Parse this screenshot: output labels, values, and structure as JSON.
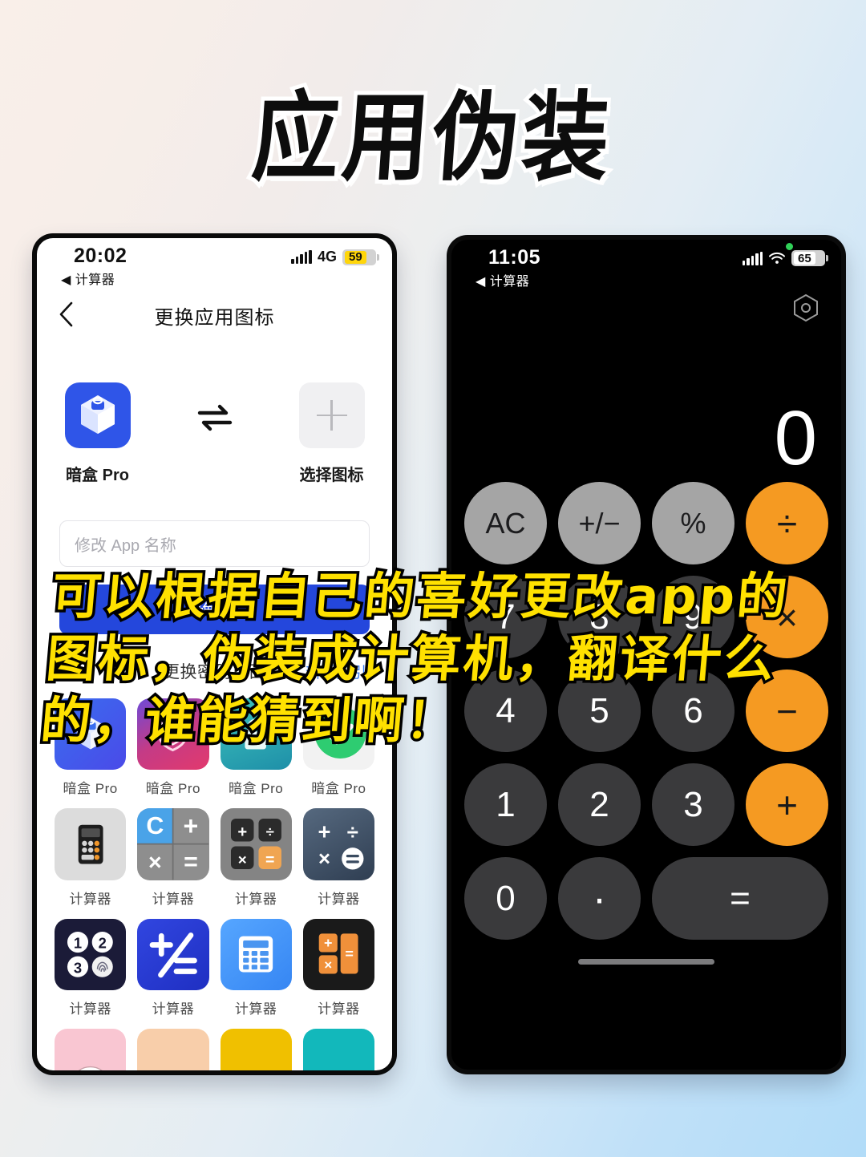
{
  "poster": {
    "title": "应用伪装",
    "caption": "可以根据自己的喜好更改app的图标，伪装成计算机，翻译什么的，谁能猜到啊！"
  },
  "left_phone": {
    "status": {
      "time": "20:02",
      "back_label": "◀ 计算器",
      "network": "4G",
      "battery": "59"
    },
    "nav": {
      "title": "更换应用图标"
    },
    "current_icon": {
      "label": "暗盒 Pro"
    },
    "picker": {
      "label": "选择图标"
    },
    "name_input": {
      "placeholder": "修改 App 名称",
      "value": ""
    },
    "confirm_button": "确定",
    "section": {
      "title": "更换密码页面",
      "link": "新手指引"
    },
    "icon_grid": [
      {
        "label": "暗盒 Pro",
        "icon": "box-blue-icon",
        "color": "#3359e6"
      },
      {
        "label": "暗盒 Pro",
        "icon": "shield-pink-icon",
        "color": "#d63a7a"
      },
      {
        "label": "暗盒 Pro",
        "icon": "lock-teal-icon",
        "color": "#2aa8b5"
      },
      {
        "label": "暗盒 Pro",
        "icon": "green-circle-icon",
        "color": "#2ecc71"
      },
      {
        "label": "计算器",
        "icon": "calculator-gray-icon",
        "color": "#d9d9d9"
      },
      {
        "label": "计算器",
        "icon": "calculator-quad-c-icon",
        "color": "#8a8a8a"
      },
      {
        "label": "计算器",
        "icon": "calculator-keys-icon",
        "color": "#7d7d7d"
      },
      {
        "label": "计算器",
        "icon": "calculator-navy-icon",
        "color": "#44566e"
      },
      {
        "label": "计算器",
        "icon": "calculator-numpad-icon",
        "color": "#1e1e3c"
      },
      {
        "label": "计算器",
        "icon": "calculator-plusdiv-icon",
        "color": "#2b3fd6"
      },
      {
        "label": "计算器",
        "icon": "calculator-lightblue-icon",
        "color": "#3d8bf5"
      },
      {
        "label": "计算器",
        "icon": "calculator-orange-black-icon",
        "color": "#1a1a1a"
      },
      {
        "label": "",
        "icon": "pink-tile-icon",
        "color": "#f9c6d2"
      },
      {
        "label": "",
        "icon": "peach-tile-icon",
        "color": "#f8ceaa"
      },
      {
        "label": "",
        "icon": "yellow-tile-icon",
        "color": "#f0c000"
      },
      {
        "label": "",
        "icon": "teal-tile-icon",
        "color": "#12b8bb"
      }
    ]
  },
  "right_phone": {
    "status": {
      "time": "11:05",
      "back_label": "◀ 计算器",
      "battery": "65"
    },
    "calculator": {
      "display": "0",
      "keys": [
        {
          "label": "AC",
          "type": "fn"
        },
        {
          "label": "+/−",
          "type": "fn"
        },
        {
          "label": "%",
          "type": "fn"
        },
        {
          "label": "÷",
          "type": "op"
        },
        {
          "label": "7",
          "type": "num"
        },
        {
          "label": "8",
          "type": "num"
        },
        {
          "label": "9",
          "type": "num"
        },
        {
          "label": "×",
          "type": "op"
        },
        {
          "label": "4",
          "type": "num"
        },
        {
          "label": "5",
          "type": "num"
        },
        {
          "label": "6",
          "type": "num"
        },
        {
          "label": "−",
          "type": "op"
        },
        {
          "label": "1",
          "type": "num"
        },
        {
          "label": "2",
          "type": "num"
        },
        {
          "label": "3",
          "type": "num"
        },
        {
          "label": "+",
          "type": "op"
        },
        {
          "label": "0",
          "type": "num"
        },
        {
          "label": "·",
          "type": "dot"
        },
        {
          "label": "=",
          "type": "eq"
        }
      ]
    }
  }
}
